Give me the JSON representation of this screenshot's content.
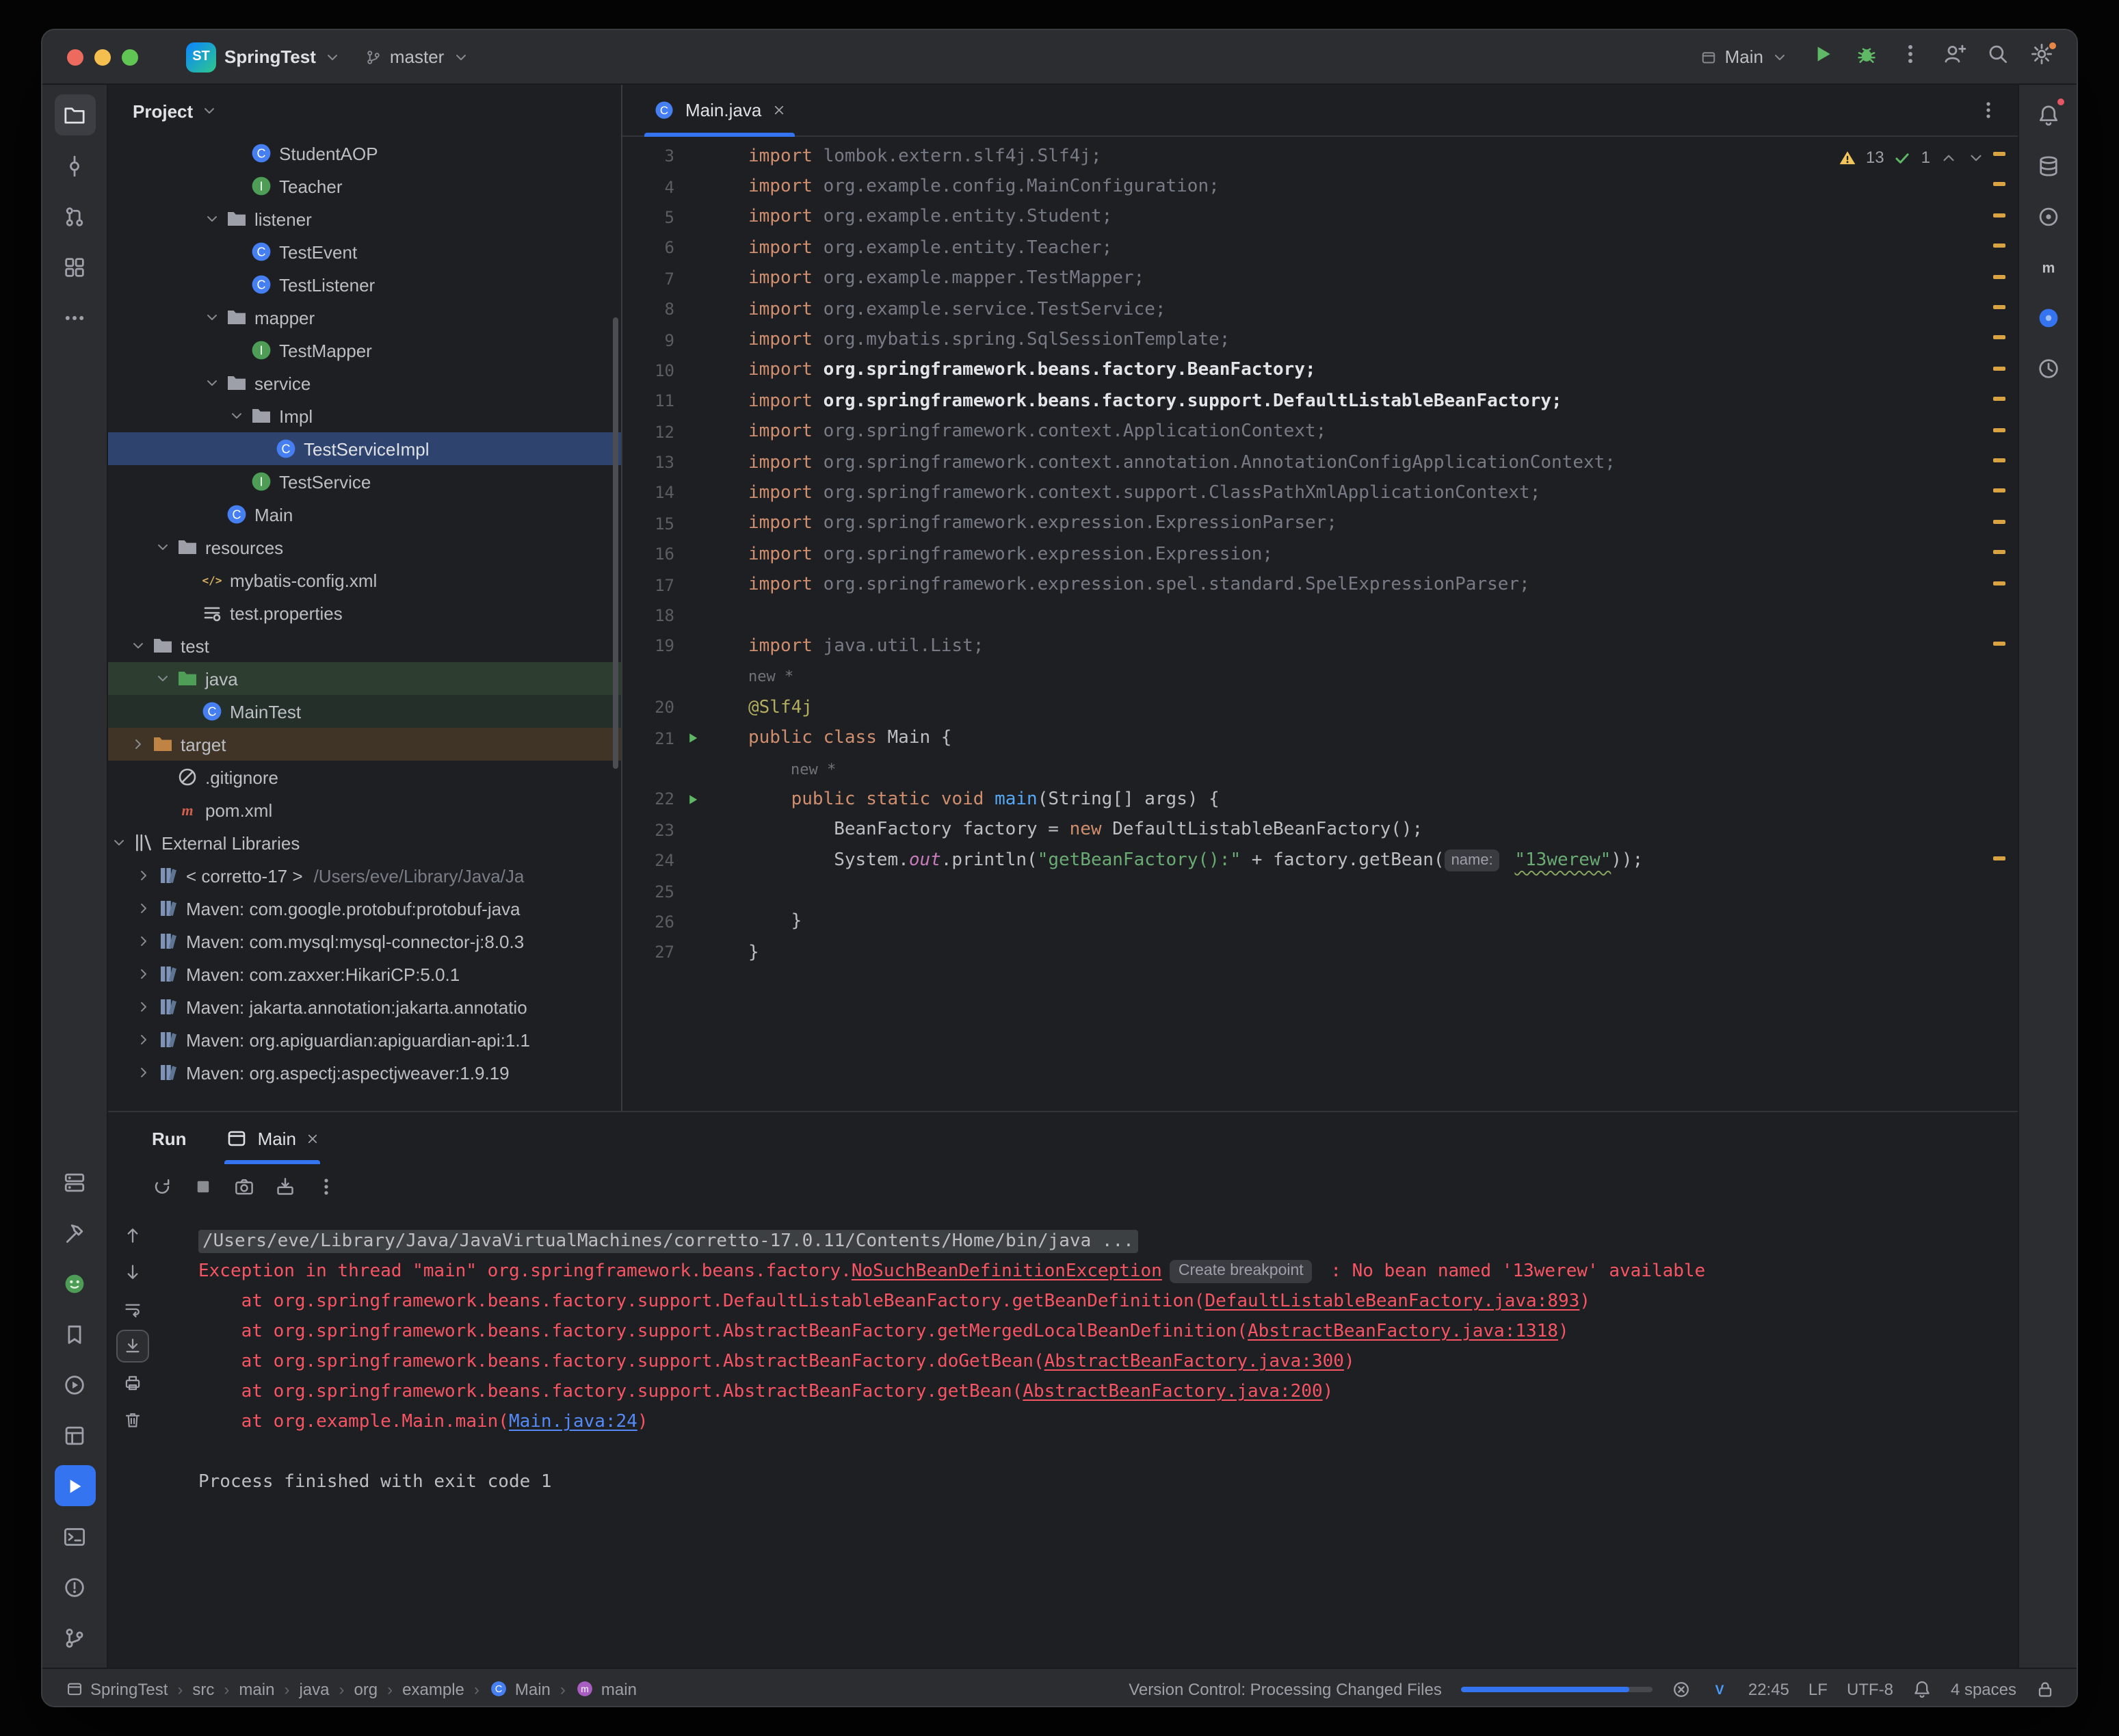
{
  "colors": {
    "accent": "#3574F0",
    "selection": "#2E436E",
    "error": "#F75464",
    "warning_stripe": "#D9A343",
    "string": "#6AAB73",
    "keyword": "#CF8E6D",
    "link": "#548AF7",
    "run_green": "#5FB865",
    "test_green": "#57965C",
    "excluded_orange": "#BF8443"
  },
  "titlebar": {
    "project_badge": "ST",
    "project_name": "SpringTest",
    "branch_name": "master",
    "run_config_name": "Main",
    "buttons": [
      "run",
      "debug",
      "more",
      "add-user",
      "search",
      "settings"
    ]
  },
  "left_rail": {
    "top": [
      {
        "name": "project",
        "icon": "folder-tool",
        "active": true
      },
      {
        "name": "commit",
        "icon": "commit"
      },
      {
        "name": "pull-requests",
        "icon": "pull-requests"
      },
      {
        "name": "structure",
        "icon": "structure"
      },
      {
        "name": "more-tools",
        "icon": "more"
      }
    ],
    "bottom": [
      {
        "name": "services",
        "icon": "services"
      },
      {
        "name": "build",
        "icon": "build"
      },
      {
        "name": "ai-plugin",
        "icon": "ai-plugin"
      },
      {
        "name": "bookmarks",
        "icon": "bookmarks"
      },
      {
        "name": "run-dashboard",
        "icon": "run-dashboard"
      },
      {
        "name": "packages",
        "icon": "packages"
      },
      {
        "name": "run",
        "icon": "run-active",
        "active_blue": true
      },
      {
        "name": "terminal",
        "icon": "terminal"
      },
      {
        "name": "problems",
        "icon": "problems"
      },
      {
        "name": "version-control",
        "icon": "branch"
      }
    ]
  },
  "right_rail": [
    {
      "name": "notifications",
      "icon": "bell",
      "badge": true
    },
    {
      "name": "database",
      "icon": "database"
    },
    {
      "name": "devtools",
      "icon": "donut"
    },
    {
      "name": "maven",
      "icon": "maven-m"
    },
    {
      "name": "ai-assistant",
      "icon": "ai-chat"
    },
    {
      "name": "profiler",
      "icon": "profiler"
    }
  ],
  "project_panel": {
    "title": "Project",
    "tree": [
      {
        "label": "StudentAOP",
        "icon": "class",
        "pad": 86
      },
      {
        "label": "Teacher",
        "icon": "interface",
        "pad": 86
      },
      {
        "label": "listener",
        "icon": "folder",
        "pad": 68,
        "chevron": "down"
      },
      {
        "label": "TestEvent",
        "icon": "class",
        "pad": 86
      },
      {
        "label": "TestListener",
        "icon": "class",
        "pad": 86
      },
      {
        "label": "mapper",
        "icon": "folder",
        "pad": 68,
        "chevron": "down"
      },
      {
        "label": "TestMapper",
        "icon": "interface",
        "pad": 86
      },
      {
        "label": "service",
        "icon": "folder",
        "pad": 68,
        "chevron": "down"
      },
      {
        "label": "Impl",
        "icon": "folder",
        "pad": 86,
        "chevron": "down"
      },
      {
        "label": "TestServiceImpl",
        "icon": "class",
        "pad": 104,
        "state": "selected"
      },
      {
        "label": "TestService",
        "icon": "interface",
        "pad": 86
      },
      {
        "label": "Main",
        "icon": "class",
        "pad": 68
      },
      {
        "label": "resources",
        "icon": "folder",
        "pad": 32,
        "chevron": "down"
      },
      {
        "label": "mybatis-config.xml",
        "icon": "xml",
        "pad": 50
      },
      {
        "label": "test.properties",
        "icon": "properties",
        "pad": 50
      },
      {
        "label": "test",
        "icon": "folder",
        "pad": 14,
        "chevron": "down"
      },
      {
        "label": "java",
        "icon": "folder-test",
        "pad": 32,
        "chevron": "down",
        "state": "green"
      },
      {
        "label": "MainTest",
        "icon": "class",
        "pad": 50,
        "state": "green2"
      },
      {
        "label": "target",
        "icon": "folder-excluded",
        "pad": 14,
        "chevron": "right",
        "state": "orange"
      },
      {
        "label": ".gitignore",
        "icon": "ignored",
        "pad": 32
      },
      {
        "label": "pom.xml",
        "icon": "maven-file",
        "pad": 32
      },
      {
        "label": "External Libraries",
        "icon": "libraries",
        "pad": 0,
        "chevron": "down"
      },
      {
        "label": "< corretto-17 >",
        "extra": "/Users/eve/Library/Java/Ja",
        "icon": "library",
        "pad": 18,
        "chevron": "right"
      },
      {
        "label": "Maven: com.google.protobuf:protobuf-java",
        "icon": "library",
        "pad": 18,
        "chevron": "right"
      },
      {
        "label": "Maven: com.mysql:mysql-connector-j:8.0.3",
        "icon": "library",
        "pad": 18,
        "chevron": "right"
      },
      {
        "label": "Maven: com.zaxxer:HikariCP:5.0.1",
        "icon": "library",
        "pad": 18,
        "chevron": "right"
      },
      {
        "label": "Maven: jakarta.annotation:jakarta.annotatio",
        "icon": "library",
        "pad": 18,
        "chevron": "right"
      },
      {
        "label": "Maven: org.apiguardian:apiguardian-api:1.1",
        "icon": "library",
        "pad": 18,
        "chevron": "right"
      },
      {
        "label": "Maven: org.aspectj:aspectjweaver:1.9.19",
        "icon": "library",
        "pad": 18,
        "chevron": "right"
      }
    ]
  },
  "editor": {
    "tab": {
      "label": "Main.java"
    },
    "inspections": {
      "warnings": "13",
      "passed": "1"
    },
    "stripe_rows": [
      0,
      1,
      2,
      3,
      4,
      5,
      6,
      7,
      8,
      9,
      10,
      11,
      12,
      13,
      14,
      16,
      23
    ],
    "lines": [
      {
        "n": 3,
        "seg": [
          [
            "kw",
            "import"
          ],
          [
            "dim",
            " lombok.extern.slf4j.Slf4j;"
          ]
        ]
      },
      {
        "n": 4,
        "seg": [
          [
            "kw",
            "import"
          ],
          [
            "dim",
            " org.example.config.MainConfiguration;"
          ]
        ]
      },
      {
        "n": 5,
        "seg": [
          [
            "kw",
            "import"
          ],
          [
            "dim",
            " org.example.entity.Student;"
          ]
        ]
      },
      {
        "n": 6,
        "seg": [
          [
            "kw",
            "import"
          ],
          [
            "dim",
            " org.example.entity.Teacher;"
          ]
        ]
      },
      {
        "n": 7,
        "seg": [
          [
            "kw",
            "import"
          ],
          [
            "dim",
            " org.example.mapper.TestMapper;"
          ]
        ]
      },
      {
        "n": 8,
        "seg": [
          [
            "kw",
            "import"
          ],
          [
            "dim",
            " org.example.service.TestService;"
          ]
        ]
      },
      {
        "n": 9,
        "seg": [
          [
            "kw",
            "import"
          ],
          [
            "dim",
            " org.mybatis.spring.SqlSessionTemplate;"
          ]
        ]
      },
      {
        "n": 10,
        "seg": [
          [
            "kw",
            "import"
          ],
          [
            "use",
            " org.springframework.beans.factory.BeanFactory;"
          ]
        ]
      },
      {
        "n": 11,
        "seg": [
          [
            "kw",
            "import"
          ],
          [
            "use",
            " org.springframework.beans.factory.support.DefaultListableBeanFactory;"
          ]
        ]
      },
      {
        "n": 12,
        "seg": [
          [
            "kw",
            "import"
          ],
          [
            "dim",
            " org.springframework.context.ApplicationContext;"
          ]
        ]
      },
      {
        "n": 13,
        "seg": [
          [
            "kw",
            "import"
          ],
          [
            "dim",
            " org.springframework.context.annotation.AnnotationConfigApplicationContext;"
          ]
        ]
      },
      {
        "n": 14,
        "seg": [
          [
            "kw",
            "import"
          ],
          [
            "dim",
            " org.springframework.context.support.ClassPathXmlApplicationContext;"
          ]
        ]
      },
      {
        "n": 15,
        "seg": [
          [
            "kw",
            "import"
          ],
          [
            "dim",
            " org.springframework.expression.ExpressionParser;"
          ]
        ]
      },
      {
        "n": 16,
        "seg": [
          [
            "kw",
            "import"
          ],
          [
            "dim",
            " org.springframework.expression.Expression;"
          ]
        ]
      },
      {
        "n": 17,
        "seg": [
          [
            "kw",
            "import"
          ],
          [
            "dim",
            " org.springframework.expression.spel.standard.SpelExpressionParser;"
          ]
        ]
      },
      {
        "n": 18,
        "seg": []
      },
      {
        "n": 19,
        "seg": [
          [
            "kw",
            "import"
          ],
          [
            "dim",
            " java.util.List;"
          ]
        ]
      },
      {
        "inlay": "new *",
        "indent": 0
      },
      {
        "n": 20,
        "seg": [
          [
            "ann",
            "@Slf4j"
          ]
        ]
      },
      {
        "n": 21,
        "run": true,
        "seg": [
          [
            "kw",
            "public"
          ],
          [
            "pl",
            " "
          ],
          [
            "kw",
            "class"
          ],
          [
            "pl",
            " Main {"
          ]
        ]
      },
      {
        "inlay": "new *",
        "indent": 1
      },
      {
        "n": 22,
        "run": true,
        "seg": [
          [
            "pl",
            "    "
          ],
          [
            "kw",
            "public"
          ],
          [
            "pl",
            " "
          ],
          [
            "kw",
            "static"
          ],
          [
            "pl",
            " "
          ],
          [
            "kw",
            "void"
          ],
          [
            "pl",
            " "
          ],
          [
            "fn",
            "main"
          ],
          [
            "pl",
            "(String[] args) {"
          ]
        ]
      },
      {
        "n": 23,
        "seg": [
          [
            "pl",
            "        BeanFactory factory = "
          ],
          [
            "kw",
            "new"
          ],
          [
            "pl",
            " DefaultListableBeanFactory();"
          ]
        ]
      },
      {
        "n": 24,
        "seg": [
          [
            "pl",
            "        System."
          ],
          [
            "field",
            "out"
          ],
          [
            "pl",
            ".println("
          ],
          [
            "str",
            "\"getBeanFactory():\""
          ],
          [
            "pl",
            " + factory.getBean("
          ],
          [
            "hint",
            "name:"
          ],
          [
            "pl",
            " "
          ],
          [
            "strw",
            "\"13werew\""
          ],
          [
            "pl",
            "));"
          ]
        ]
      },
      {
        "n": 25,
        "seg": []
      },
      {
        "n": 26,
        "seg": [
          [
            "pl",
            "    }"
          ]
        ]
      },
      {
        "n": 27,
        "seg": [
          [
            "pl",
            "}"
          ]
        ]
      }
    ]
  },
  "run_panel": {
    "title": "Run",
    "tab_label": "Main",
    "toolbar": [
      {
        "name": "rerun",
        "icon": "rerun"
      },
      {
        "name": "stop",
        "icon": "stop"
      },
      {
        "name": "screenshot",
        "icon": "camera"
      },
      {
        "name": "import-results",
        "icon": "import"
      },
      {
        "name": "more-options",
        "icon": "kebab"
      }
    ],
    "mini_rail": [
      {
        "name": "scroll-up",
        "icon": "arrow-up"
      },
      {
        "name": "scroll-down",
        "icon": "arrow-down"
      },
      {
        "name": "soft-wrap",
        "icon": "softwrap"
      },
      {
        "name": "scroll-to-end",
        "icon": "scroll-end",
        "boxed": true
      },
      {
        "name": "print",
        "icon": "printer"
      },
      {
        "name": "clear-all",
        "icon": "trash"
      }
    ],
    "console": [
      {
        "hl": true,
        "seg": [
          [
            "path",
            "/Users/eve/Library/Java/JavaVirtualMachines/corretto-17.0.11/Contents/Home/bin/java ..."
          ]
        ]
      },
      {
        "seg": [
          [
            "err",
            "Exception in thread \"main\" org.springframework.beans.factory."
          ],
          [
            "exlink",
            "NoSuchBeanDefinitionException"
          ],
          [
            "badge",
            "Create breakpoint"
          ],
          [
            "err",
            " : No bean named '13werew' available"
          ]
        ]
      },
      {
        "seg": [
          [
            "err",
            "    at org.springframework.beans.factory.support.DefaultListableBeanFactory.getBeanDefinition("
          ],
          [
            "exlink",
            "DefaultListableBeanFactory.java:893"
          ],
          [
            "err",
            ")"
          ]
        ]
      },
      {
        "seg": [
          [
            "err",
            "    at org.springframework.beans.factory.support.AbstractBeanFactory.getMergedLocalBeanDefinition("
          ],
          [
            "exlink",
            "AbstractBeanFactory.java:1318"
          ],
          [
            "err",
            ")"
          ]
        ]
      },
      {
        "seg": [
          [
            "err",
            "    at org.springframework.beans.factory.support.AbstractBeanFactory.doGetBean("
          ],
          [
            "exlink",
            "AbstractBeanFactory.java:300"
          ],
          [
            "err",
            ")"
          ]
        ]
      },
      {
        "seg": [
          [
            "err",
            "    at org.springframework.beans.factory.support.AbstractBeanFactory.getBean("
          ],
          [
            "exlink",
            "AbstractBeanFactory.java:200"
          ],
          [
            "err",
            ")"
          ]
        ]
      },
      {
        "seg": [
          [
            "err",
            "    at org.example.Main.main("
          ],
          [
            "link",
            "Main.java:24"
          ],
          [
            "err",
            ")"
          ]
        ]
      },
      {
        "seg": [
          [
            "plain",
            ""
          ]
        ]
      },
      {
        "seg": [
          [
            "plain",
            "Process finished with exit code 1"
          ]
        ]
      }
    ]
  },
  "status_bar": {
    "breadcrumbs": [
      {
        "label": "SpringTest",
        "icon": "window-chip"
      },
      {
        "label": "src"
      },
      {
        "label": "main"
      },
      {
        "label": "java"
      },
      {
        "label": "org"
      },
      {
        "label": "example"
      },
      {
        "label": "Main",
        "icon": "class"
      },
      {
        "label": "main",
        "icon": "method"
      }
    ],
    "vcs_message": "Version Control: Processing Changed Files",
    "time": "22:45",
    "line_separator": "LF",
    "encoding": "UTF-8",
    "indent": "4 spaces"
  }
}
